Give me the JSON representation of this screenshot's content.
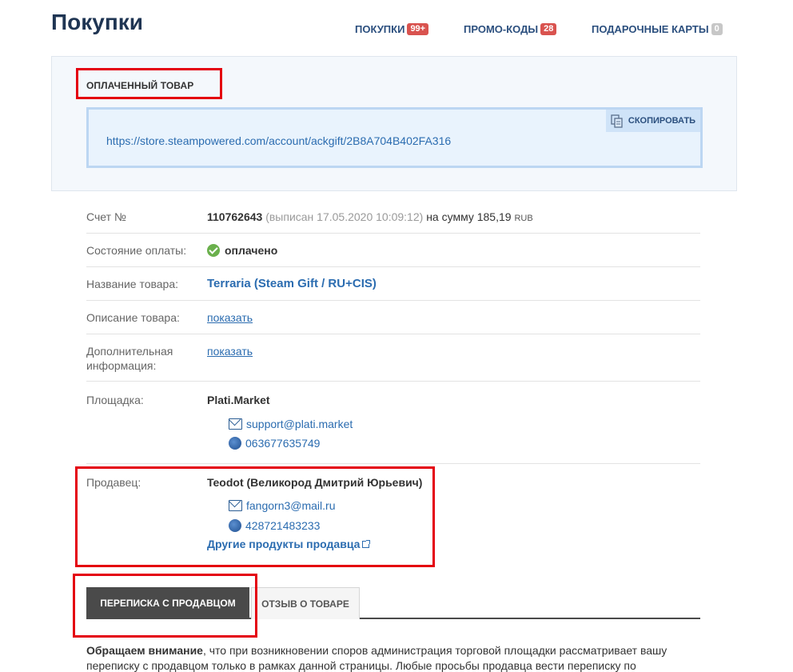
{
  "header": {
    "title": "Покупки",
    "nav": [
      {
        "label": "ПОКУПКИ",
        "badge": "99+"
      },
      {
        "label": "ПРОМО-КОДЫ",
        "badge": "28"
      },
      {
        "label": "ПОДАРОЧНЫЕ КАРТЫ",
        "badge": "0"
      }
    ]
  },
  "paid": {
    "title": "ОПЛАЧЕННЫЙ ТОВАР",
    "link": "https://store.steampowered.com/account/ackgift/2B8A704B402FA316",
    "copy_label": "СКОПИРОВАТЬ"
  },
  "details": {
    "invoice": {
      "label": "Счет №",
      "number": "110762643",
      "issued": "(выписан 17.05.2020 10:09:12)",
      "amount_prefix": "на сумму 185,19",
      "currency": "RUB"
    },
    "payment": {
      "label": "Состояние оплаты:",
      "value": "оплачено"
    },
    "product": {
      "label": "Название товара:",
      "value": "Terraria (Steam Gift / RU+CIS)"
    },
    "description": {
      "label": "Описание товара:",
      "link": "показать"
    },
    "extra": {
      "label_line1": "Дополнительная",
      "label_line2": "информация:",
      "link": "показать"
    },
    "platform": {
      "label": "Площадка:",
      "name": "Plati.Market",
      "email": "support@plati.market",
      "wmid": "063677635749"
    },
    "seller": {
      "label": "Продавец:",
      "name": "Teodot (Великород Дмитрий Юрьевич)",
      "email": "fangorn3@mail.ru",
      "wmid": "428721483233",
      "other_products": "Другие продукты продавца"
    }
  },
  "tabs": [
    {
      "label": "ПЕРЕПИСКА С ПРОДАВЦОМ",
      "active": true
    },
    {
      "label": "ОТЗЫВ О ТОВАРЕ",
      "active": false
    }
  ],
  "notice": {
    "bold": "Обращаем внимание",
    "line1": ", что при возникновении споров администрация торговой площадки рассматривает вашу",
    "line2": "переписку с продавцом только в рамках данной страницы. Любые просьбы продавца вести переписку по"
  },
  "colors": {
    "accent": "#2b6cb0",
    "badge": "#d9534f",
    "highlight": "#e4000f",
    "tab_active": "#4a4a4a"
  }
}
